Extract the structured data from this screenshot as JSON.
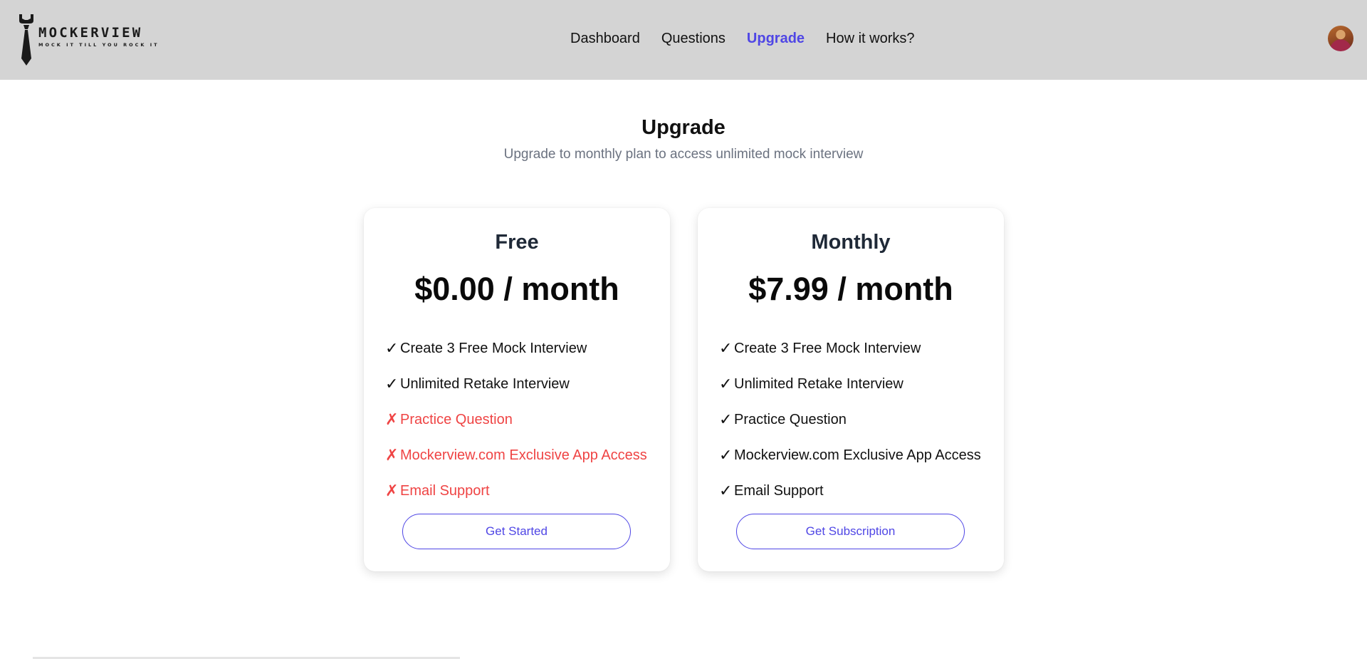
{
  "brand": {
    "name": "MOCKERVIEW",
    "tagline": "MOCK IT TILL YOU ROCK IT"
  },
  "nav": {
    "items": [
      {
        "label": "Dashboard",
        "active": false
      },
      {
        "label": "Questions",
        "active": false
      },
      {
        "label": "Upgrade",
        "active": true
      },
      {
        "label": "How it works?",
        "active": false
      }
    ],
    "active_color": "#4f46e5"
  },
  "page": {
    "title": "Upgrade",
    "subtitle": "Upgrade to monthly plan to access unlimited mock interview"
  },
  "plans": [
    {
      "name": "Free",
      "price": "$0.00 / month",
      "features": [
        {
          "mark": "✓",
          "label": "Create 3 Free Mock Interview",
          "included": true
        },
        {
          "mark": "✓",
          "label": "Unlimited Retake Interview",
          "included": true
        },
        {
          "mark": "✗",
          "label": "Practice Question",
          "included": false
        },
        {
          "mark": "✗",
          "label": "Mockerview.com Exclusive App Access",
          "included": false
        },
        {
          "mark": "✗",
          "label": "Email Support",
          "included": false
        }
      ],
      "button_label": "Get Started"
    },
    {
      "name": "Monthly",
      "price": "$7.99 / month",
      "features": [
        {
          "mark": "✓",
          "label": "Create 3 Free Mock Interview",
          "included": true
        },
        {
          "mark": "✓",
          "label": "Unlimited Retake Interview",
          "included": true
        },
        {
          "mark": "✓",
          "label": "Practice Question",
          "included": true
        },
        {
          "mark": "✓",
          "label": "Mockerview.com Exclusive App Access",
          "included": true
        },
        {
          "mark": "✓",
          "label": "Email Support",
          "included": true
        }
      ],
      "button_label": "Get Subscription"
    }
  ],
  "colors": {
    "header_bg": "#d4d4d4",
    "excluded": "#ef4444",
    "accent": "#4f46e5"
  },
  "icons": {
    "logo": "necktie-wrench-icon",
    "avatar": "user-avatar",
    "check": "check-icon",
    "cross": "cross-icon"
  }
}
